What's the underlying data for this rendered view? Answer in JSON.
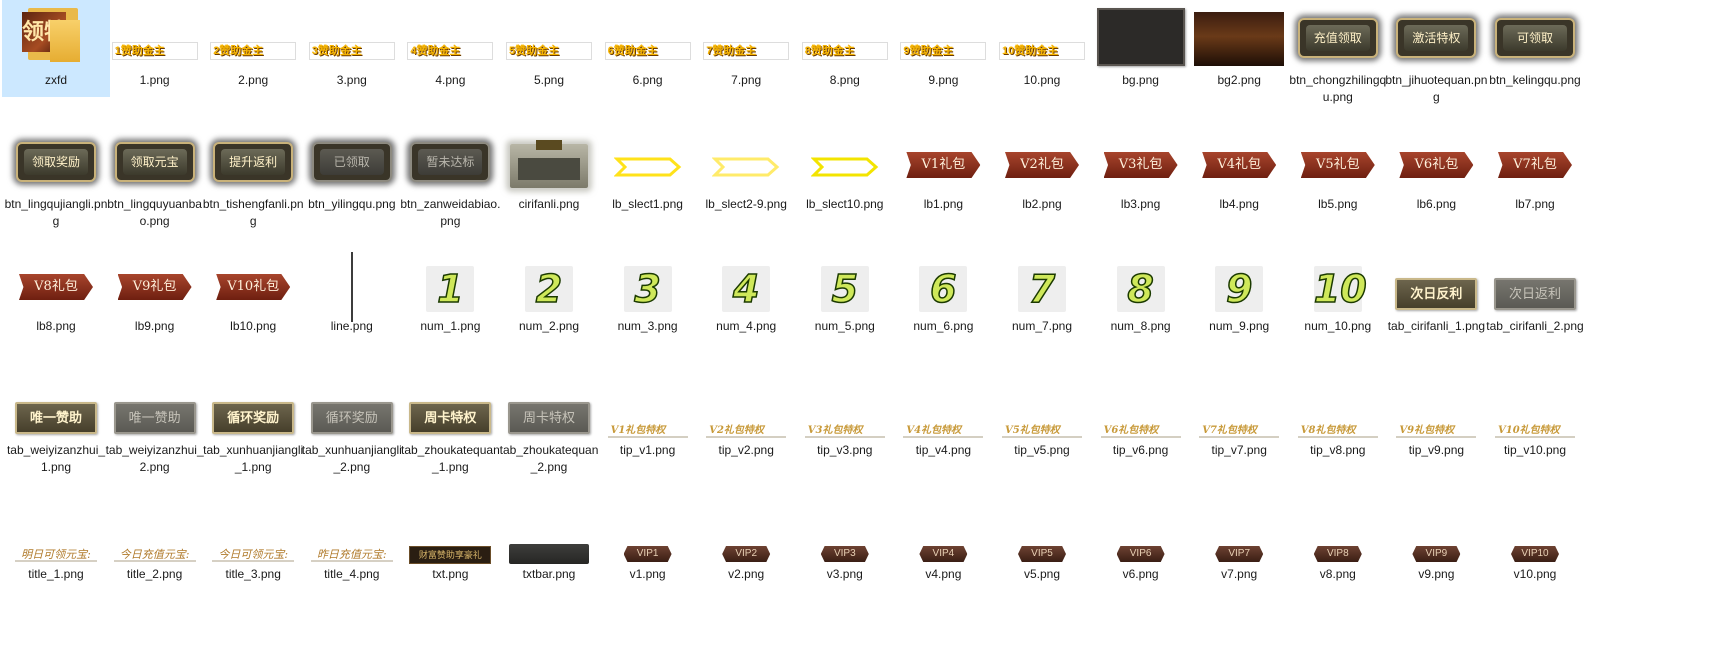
{
  "rows": [
    {
      "items": [
        {
          "label": "zxfd",
          "kind": "folder",
          "selected": true,
          "text": "领特"
        },
        {
          "label": "1.png",
          "kind": "zanzhu",
          "text": "1赞助金主"
        },
        {
          "label": "2.png",
          "kind": "zanzhu",
          "text": "2赞助金主"
        },
        {
          "label": "3.png",
          "kind": "zanzhu",
          "text": "3赞助金主"
        },
        {
          "label": "4.png",
          "kind": "zanzhu",
          "text": "4赞助金主"
        },
        {
          "label": "5.png",
          "kind": "zanzhu",
          "text": "5赞助金主"
        },
        {
          "label": "6.png",
          "kind": "zanzhu",
          "text": "6赞助金主"
        },
        {
          "label": "7.png",
          "kind": "zanzhu",
          "text": "7赞助金主"
        },
        {
          "label": "8.png",
          "kind": "zanzhu",
          "text": "8赞助金主"
        },
        {
          "label": "9.png",
          "kind": "zanzhu",
          "text": "9赞助金主"
        },
        {
          "label": "10.png",
          "kind": "zanzhu",
          "text": "10赞助金主"
        },
        {
          "label": "bg.png",
          "kind": "bgdark",
          "text": ""
        },
        {
          "label": "bg2.png",
          "kind": "bgimg",
          "text": ""
        },
        {
          "label": "btn_chongzhilingqu.png",
          "kind": "gbtn",
          "text": "充值领取"
        },
        {
          "label": "btn_jihuotequan.png",
          "kind": "gbtn",
          "text": "激活特权"
        },
        {
          "label": "btn_kelingqu.png",
          "kind": "gbtn",
          "text": "可领取"
        }
      ]
    },
    {
      "items": [
        {
          "label": "btn_lingqujiangli.png",
          "kind": "gbtn",
          "text": "领取奖励"
        },
        {
          "label": "btn_lingquyuanbao.png",
          "kind": "gbtn",
          "text": "领取元宝"
        },
        {
          "label": "btn_tishengfanli.png",
          "kind": "gbtn",
          "text": "提升返利"
        },
        {
          "label": "btn_yilingqu.png",
          "kind": "gbtn-gray",
          "text": "已领取"
        },
        {
          "label": "btn_zanweidabiao.png",
          "kind": "gbtn-gray",
          "text": "暂未达标"
        },
        {
          "label": "cirifanli.png",
          "kind": "cirifanli",
          "text": ""
        },
        {
          "label": "lb_slect1.png",
          "kind": "chev1",
          "text": ""
        },
        {
          "label": "lb_slect2-9.png",
          "kind": "chev2",
          "text": ""
        },
        {
          "label": "lb_slect10.png",
          "kind": "chev3",
          "text": ""
        },
        {
          "label": "lb1.png",
          "kind": "lb",
          "text": "V1礼包"
        },
        {
          "label": "lb2.png",
          "kind": "lb",
          "text": "V2礼包"
        },
        {
          "label": "lb3.png",
          "kind": "lb",
          "text": "V3礼包"
        },
        {
          "label": "lb4.png",
          "kind": "lb",
          "text": "V4礼包"
        },
        {
          "label": "lb5.png",
          "kind": "lb",
          "text": "V5礼包"
        },
        {
          "label": "lb6.png",
          "kind": "lb",
          "text": "V6礼包"
        },
        {
          "label": "lb7.png",
          "kind": "lb",
          "text": "V7礼包"
        }
      ]
    },
    {
      "items": [
        {
          "label": "lb8.png",
          "kind": "lb",
          "text": "V8礼包"
        },
        {
          "label": "lb9.png",
          "kind": "lb",
          "text": "V9礼包"
        },
        {
          "label": "lb10.png",
          "kind": "lb",
          "text": "V10礼包"
        },
        {
          "label": "line.png",
          "kind": "line",
          "text": ""
        },
        {
          "label": "num_1.png",
          "kind": "num",
          "text": "1"
        },
        {
          "label": "num_2.png",
          "kind": "num",
          "text": "2"
        },
        {
          "label": "num_3.png",
          "kind": "num",
          "text": "3"
        },
        {
          "label": "num_4.png",
          "kind": "num",
          "text": "4"
        },
        {
          "label": "num_5.png",
          "kind": "num",
          "text": "5"
        },
        {
          "label": "num_6.png",
          "kind": "num",
          "text": "6"
        },
        {
          "label": "num_7.png",
          "kind": "num",
          "text": "7"
        },
        {
          "label": "num_8.png",
          "kind": "num",
          "text": "8"
        },
        {
          "label": "num_9.png",
          "kind": "num",
          "text": "9"
        },
        {
          "label": "num_10.png",
          "kind": "num",
          "text": "10"
        },
        {
          "label": "tab_cirifanli_1.png",
          "kind": "tab",
          "text": "次日反利"
        },
        {
          "label": "tab_cirifanli_2.png",
          "kind": "tab-gray",
          "text": "次日返利"
        }
      ]
    },
    {
      "items": [
        {
          "label": "tab_weiyizanzhui_1.png",
          "kind": "tab",
          "text": "唯一赞助"
        },
        {
          "label": "tab_weiyizanzhui_2.png",
          "kind": "tab-gray",
          "text": "唯一赞助"
        },
        {
          "label": "tab_xunhuanjiangli_1.png",
          "kind": "tab",
          "text": "循环奖励"
        },
        {
          "label": "tab_xunhuanjiangli_2.png",
          "kind": "tab-gray",
          "text": "循环奖励"
        },
        {
          "label": "tab_zhoukatequan_1.png",
          "kind": "tab",
          "text": "周卡特权"
        },
        {
          "label": "tab_zhoukatequan_2.png",
          "kind": "tab-gray",
          "text": "周卡特权"
        },
        {
          "label": "tip_v1.png",
          "kind": "tip",
          "text": "V1礼包特权"
        },
        {
          "label": "tip_v2.png",
          "kind": "tip",
          "text": "V2礼包特权"
        },
        {
          "label": "tip_v3.png",
          "kind": "tip",
          "text": "V3礼包特权"
        },
        {
          "label": "tip_v4.png",
          "kind": "tip",
          "text": "V4礼包特权"
        },
        {
          "label": "tip_v5.png",
          "kind": "tip",
          "text": "V5礼包特权"
        },
        {
          "label": "tip_v6.png",
          "kind": "tip",
          "text": "V6礼包特权"
        },
        {
          "label": "tip_v7.png",
          "kind": "tip",
          "text": "V7礼包特权"
        },
        {
          "label": "tip_v8.png",
          "kind": "tip",
          "text": "V8礼包特权"
        },
        {
          "label": "tip_v9.png",
          "kind": "tip",
          "text": "V9礼包特权"
        },
        {
          "label": "tip_v10.png",
          "kind": "tip",
          "text": "V10礼包特权"
        }
      ]
    },
    {
      "items": [
        {
          "label": "title_1.png",
          "kind": "title",
          "text": "明日可领元宝:"
        },
        {
          "label": "title_2.png",
          "kind": "title",
          "text": "今日充值元宝:"
        },
        {
          "label": "title_3.png",
          "kind": "title",
          "text": "今日可领元宝:"
        },
        {
          "label": "title_4.png",
          "kind": "title",
          "text": "昨日充值元宝:"
        },
        {
          "label": "txt.png",
          "kind": "txt",
          "text": "财富赞助享豪礼"
        },
        {
          "label": "txtbar.png",
          "kind": "txtbar",
          "text": ""
        },
        {
          "label": "v1.png",
          "kind": "vip",
          "text": "VIP1"
        },
        {
          "label": "v2.png",
          "kind": "vip",
          "text": "VIP2"
        },
        {
          "label": "v3.png",
          "kind": "vip",
          "text": "VIP3"
        },
        {
          "label": "v4.png",
          "kind": "vip",
          "text": "VIP4"
        },
        {
          "label": "v5.png",
          "kind": "vip",
          "text": "VIP5"
        },
        {
          "label": "v6.png",
          "kind": "vip",
          "text": "VIP6"
        },
        {
          "label": "v7.png",
          "kind": "vip",
          "text": "VIP7"
        },
        {
          "label": "v8.png",
          "kind": "vip",
          "text": "VIP8"
        },
        {
          "label": "v9.png",
          "kind": "vip",
          "text": "VIP9"
        },
        {
          "label": "v10.png",
          "kind": "vip",
          "text": "VIP10"
        }
      ]
    }
  ],
  "colors": {
    "selection": "#cce8ff",
    "gold": "#f7b500",
    "chevron_yellow": "#ffe94a"
  }
}
